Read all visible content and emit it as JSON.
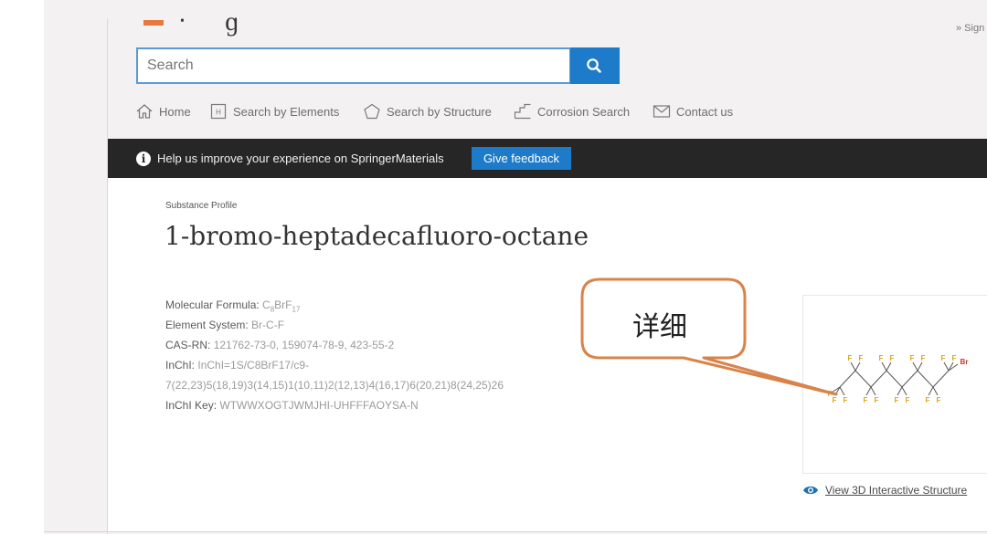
{
  "header": {
    "sign_in": "» Sign"
  },
  "search": {
    "placeholder": "Search",
    "button_icon": "search-icon"
  },
  "nav": {
    "items": [
      {
        "label": "Home",
        "icon": "home-icon"
      },
      {
        "label": "Search by Elements",
        "icon": "elements-icon"
      },
      {
        "label": "Search by Structure",
        "icon": "structure-icon"
      },
      {
        "label": "Corrosion Search",
        "icon": "corrosion-icon"
      },
      {
        "label": "Contact us",
        "icon": "envelope-icon"
      }
    ]
  },
  "feedback": {
    "text": "Help us improve your experience on SpringerMaterials",
    "button": "Give feedback"
  },
  "substance": {
    "kicker": "Substance Profile",
    "title": "1-bromo-heptadecafluoro-octane",
    "formula_label": "Molecular Formula:",
    "formula_base": "C",
    "formula_sub1": "8",
    "formula_mid": "BrF",
    "formula_sub2": "17",
    "element_system_label": "Element System:",
    "element_system": "Br-C-F",
    "cas_label": "CAS-RN:",
    "cas": "121762-73-0, 159074-78-9, 423-55-2",
    "inchi_label": "InChI:",
    "inchi_line1": "InChI=1S/C8BrF17/c9-",
    "inchi_line2": "7(22,23)5(18,19)3(14,15)1(10,11)2(12,13)4(16,17)6(20,21)8(24,25)26",
    "inchikey_label": "InChI Key:",
    "inchikey": "WTWWXOGTJWMJHI-UHFFFAOYSA-N"
  },
  "structure": {
    "atom_f": "F",
    "atom_br": "Br",
    "view3d_icon": "eye-icon",
    "view3d_label": "View 3D Interactive Structure"
  },
  "annotation": {
    "callout_text": "详细"
  },
  "colors": {
    "accent_blue": "#1e7bc9",
    "search_border": "#5a9bd3",
    "dark_bar": "#262626",
    "callout_orange": "#d9834a",
    "bromine_red": "#c0392b",
    "fluorine_gold": "#d9a620"
  }
}
